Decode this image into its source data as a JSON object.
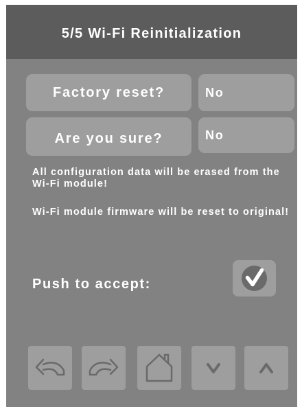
{
  "header": {
    "title": "5/5 Wi-Fi Reinitialization"
  },
  "form": {
    "factory_reset": {
      "label": "Factory reset?",
      "value": "No"
    },
    "are_you_sure": {
      "label": "Are you sure?",
      "value": "No"
    }
  },
  "messages": {
    "erase_warning": "All configuration data will be erased from the Wi-Fi module!",
    "firmware_warning": "Wi-Fi module firmware will be reset to original!"
  },
  "accept": {
    "label": "Push to accept:",
    "icon": "checkmark-icon"
  },
  "nav": {
    "buttons": [
      {
        "icon": "undo-arrow-icon"
      },
      {
        "icon": "redo-arrow-icon"
      },
      {
        "icon": "home-icon"
      },
      {
        "icon": "chevron-down-icon"
      },
      {
        "icon": "chevron-up-icon"
      }
    ]
  },
  "colors": {
    "header_bg": "#5c5c5c",
    "panel_bg": "#828282",
    "button_bg": "#9e9e9e",
    "icon_color": "#6a6a6a",
    "text": "#ffffff"
  }
}
